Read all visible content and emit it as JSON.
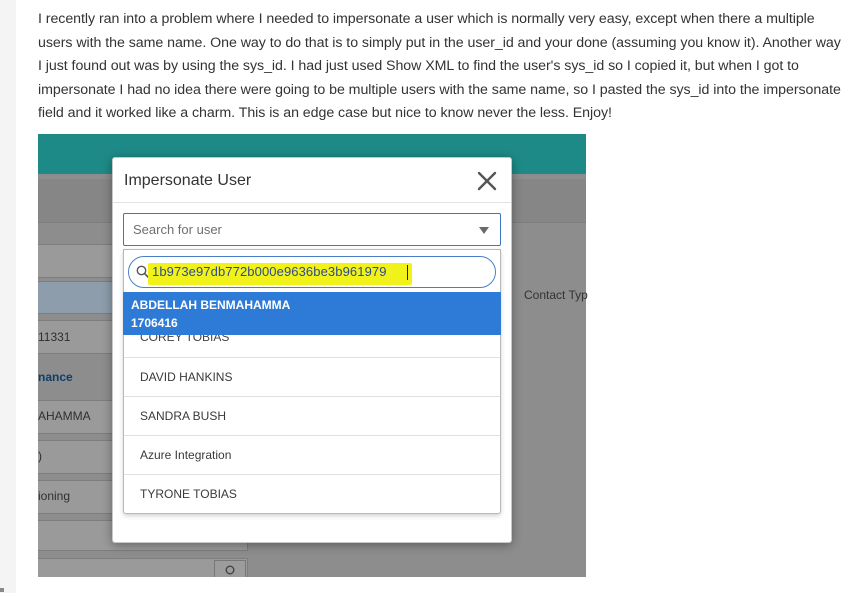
{
  "post": {
    "paragraph": "I recently ran into a problem where I needed to impersonate a user which is normally very easy, except when there a multiple users with the same name. One way to do that is to simply put in the user_id and your done (assuming you know it). Another way I just found out was by using the sys_id. I had just used Show XML to find the user's sys_id so I copied it, but when I got to impersonate I had no idea there were going to be multiple users with the same name, so I pasted the sys_id into the impersonate field and it worked like a charm. This is an edge case but nice to know never the less.  Enjoy!"
  },
  "background": {
    "labels": [
      "11331",
      "nance",
      "AHAMMA",
      ")",
      "ioning"
    ],
    "contact_label": "Contact Typ"
  },
  "modal": {
    "title": "Impersonate User",
    "close_icon": "close-icon",
    "select": {
      "placeholder": "Search for user"
    },
    "search": {
      "value": "1b973e97db772b000e9636be3b961979",
      "highlight_color": "#f2f21b"
    },
    "active_option": {
      "name": "ABDELLAH BENMAHAMMA",
      "id": "1706416"
    },
    "options": [
      "COREY TOBIAS",
      "DAVID HANKINS",
      "SANDRA BUSH",
      "Azure Integration",
      "TYRONE TOBIAS"
    ]
  },
  "colors": {
    "header_teal": "#1e8a87",
    "accent_blue": "#2d7bd6"
  }
}
